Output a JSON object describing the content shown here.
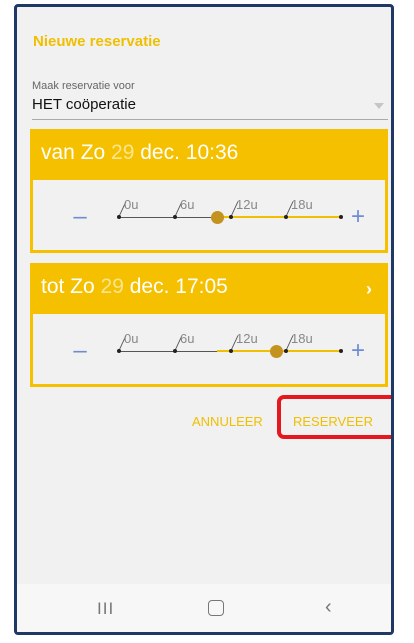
{
  "dialog": {
    "title": "Nieuwe reservatie",
    "for_label": "Maak reservatie voor",
    "for_value": "HET coöperatie"
  },
  "from": {
    "prefix": "van Zo",
    "day": "29",
    "rest": "dec. 10:36",
    "slider_value": 10.6,
    "slider_min": 0,
    "slider_max": 24,
    "ticks": [
      "0u",
      "6u",
      "12u",
      "18u"
    ],
    "minus": "–",
    "plus": "+"
  },
  "to": {
    "prefix": "tot Zo",
    "day": "29",
    "rest": "dec. 17:05",
    "chevron": "›",
    "slider_value": 17.08,
    "slider_min": 0,
    "slider_max": 24,
    "ticks": [
      "0u",
      "6u",
      "12u",
      "18u"
    ],
    "minus": "–",
    "plus": "+"
  },
  "actions": {
    "cancel": "ANNULEER",
    "reserve": "RESERVEER"
  },
  "navbar": {
    "recent": "III",
    "back": "‹"
  },
  "colors": {
    "accent": "#f4c000",
    "thumb": "#c4931f",
    "highlight": "#e5181f",
    "frame": "#1f3864",
    "stepper": "#6f8cd3"
  }
}
